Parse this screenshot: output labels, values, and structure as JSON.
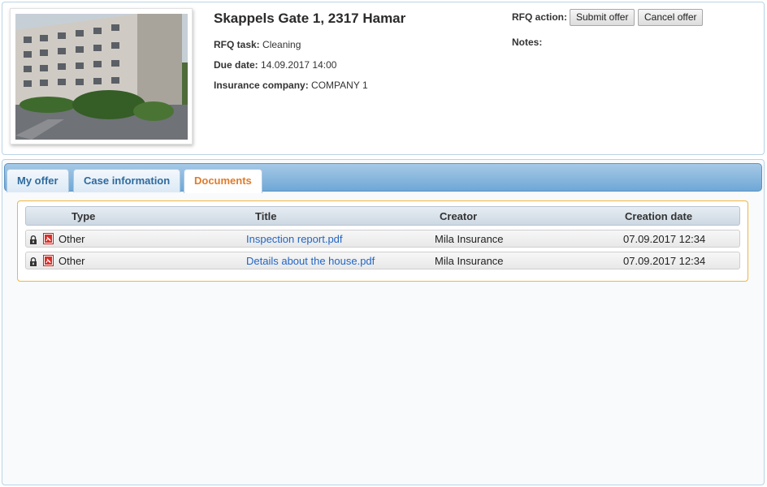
{
  "property": {
    "address": "Skappels Gate 1, 2317 Hamar",
    "rfq_task_label": "RFQ task:",
    "rfq_task_value": "Cleaning",
    "due_date_label": "Due date:",
    "due_date_value": "14.09.2017 14:00",
    "insurance_label": "Insurance company:",
    "insurance_value": "COMPANY 1"
  },
  "rfq": {
    "action_label": "RFQ action:",
    "submit_label": "Submit offer",
    "cancel_label": "Cancel offer",
    "notes_label": "Notes:"
  },
  "tabs": [
    {
      "label": "My offer"
    },
    {
      "label": "Case information"
    },
    {
      "label": "Documents",
      "active": true
    }
  ],
  "documents": {
    "columns": [
      "Type",
      "Title",
      "Creator",
      "Creation date"
    ],
    "rows": [
      {
        "type": "Other",
        "title": "Inspection report.pdf",
        "creator": "Mila Insurance",
        "date": "07.09.2017 12:34",
        "icons": [
          "lock-icon",
          "pdf-icon"
        ]
      },
      {
        "type": "Other",
        "title": "Details about the house.pdf",
        "creator": "Mila Insurance",
        "date": "07.09.2017 12:34",
        "icons": [
          "lock-icon",
          "pdf-icon"
        ]
      }
    ]
  },
  "colors": {
    "active_tab": "#e07b2a",
    "link": "#2266c4",
    "docs_border": "#f0b63e",
    "tab_bar": "#6fa8d6"
  }
}
